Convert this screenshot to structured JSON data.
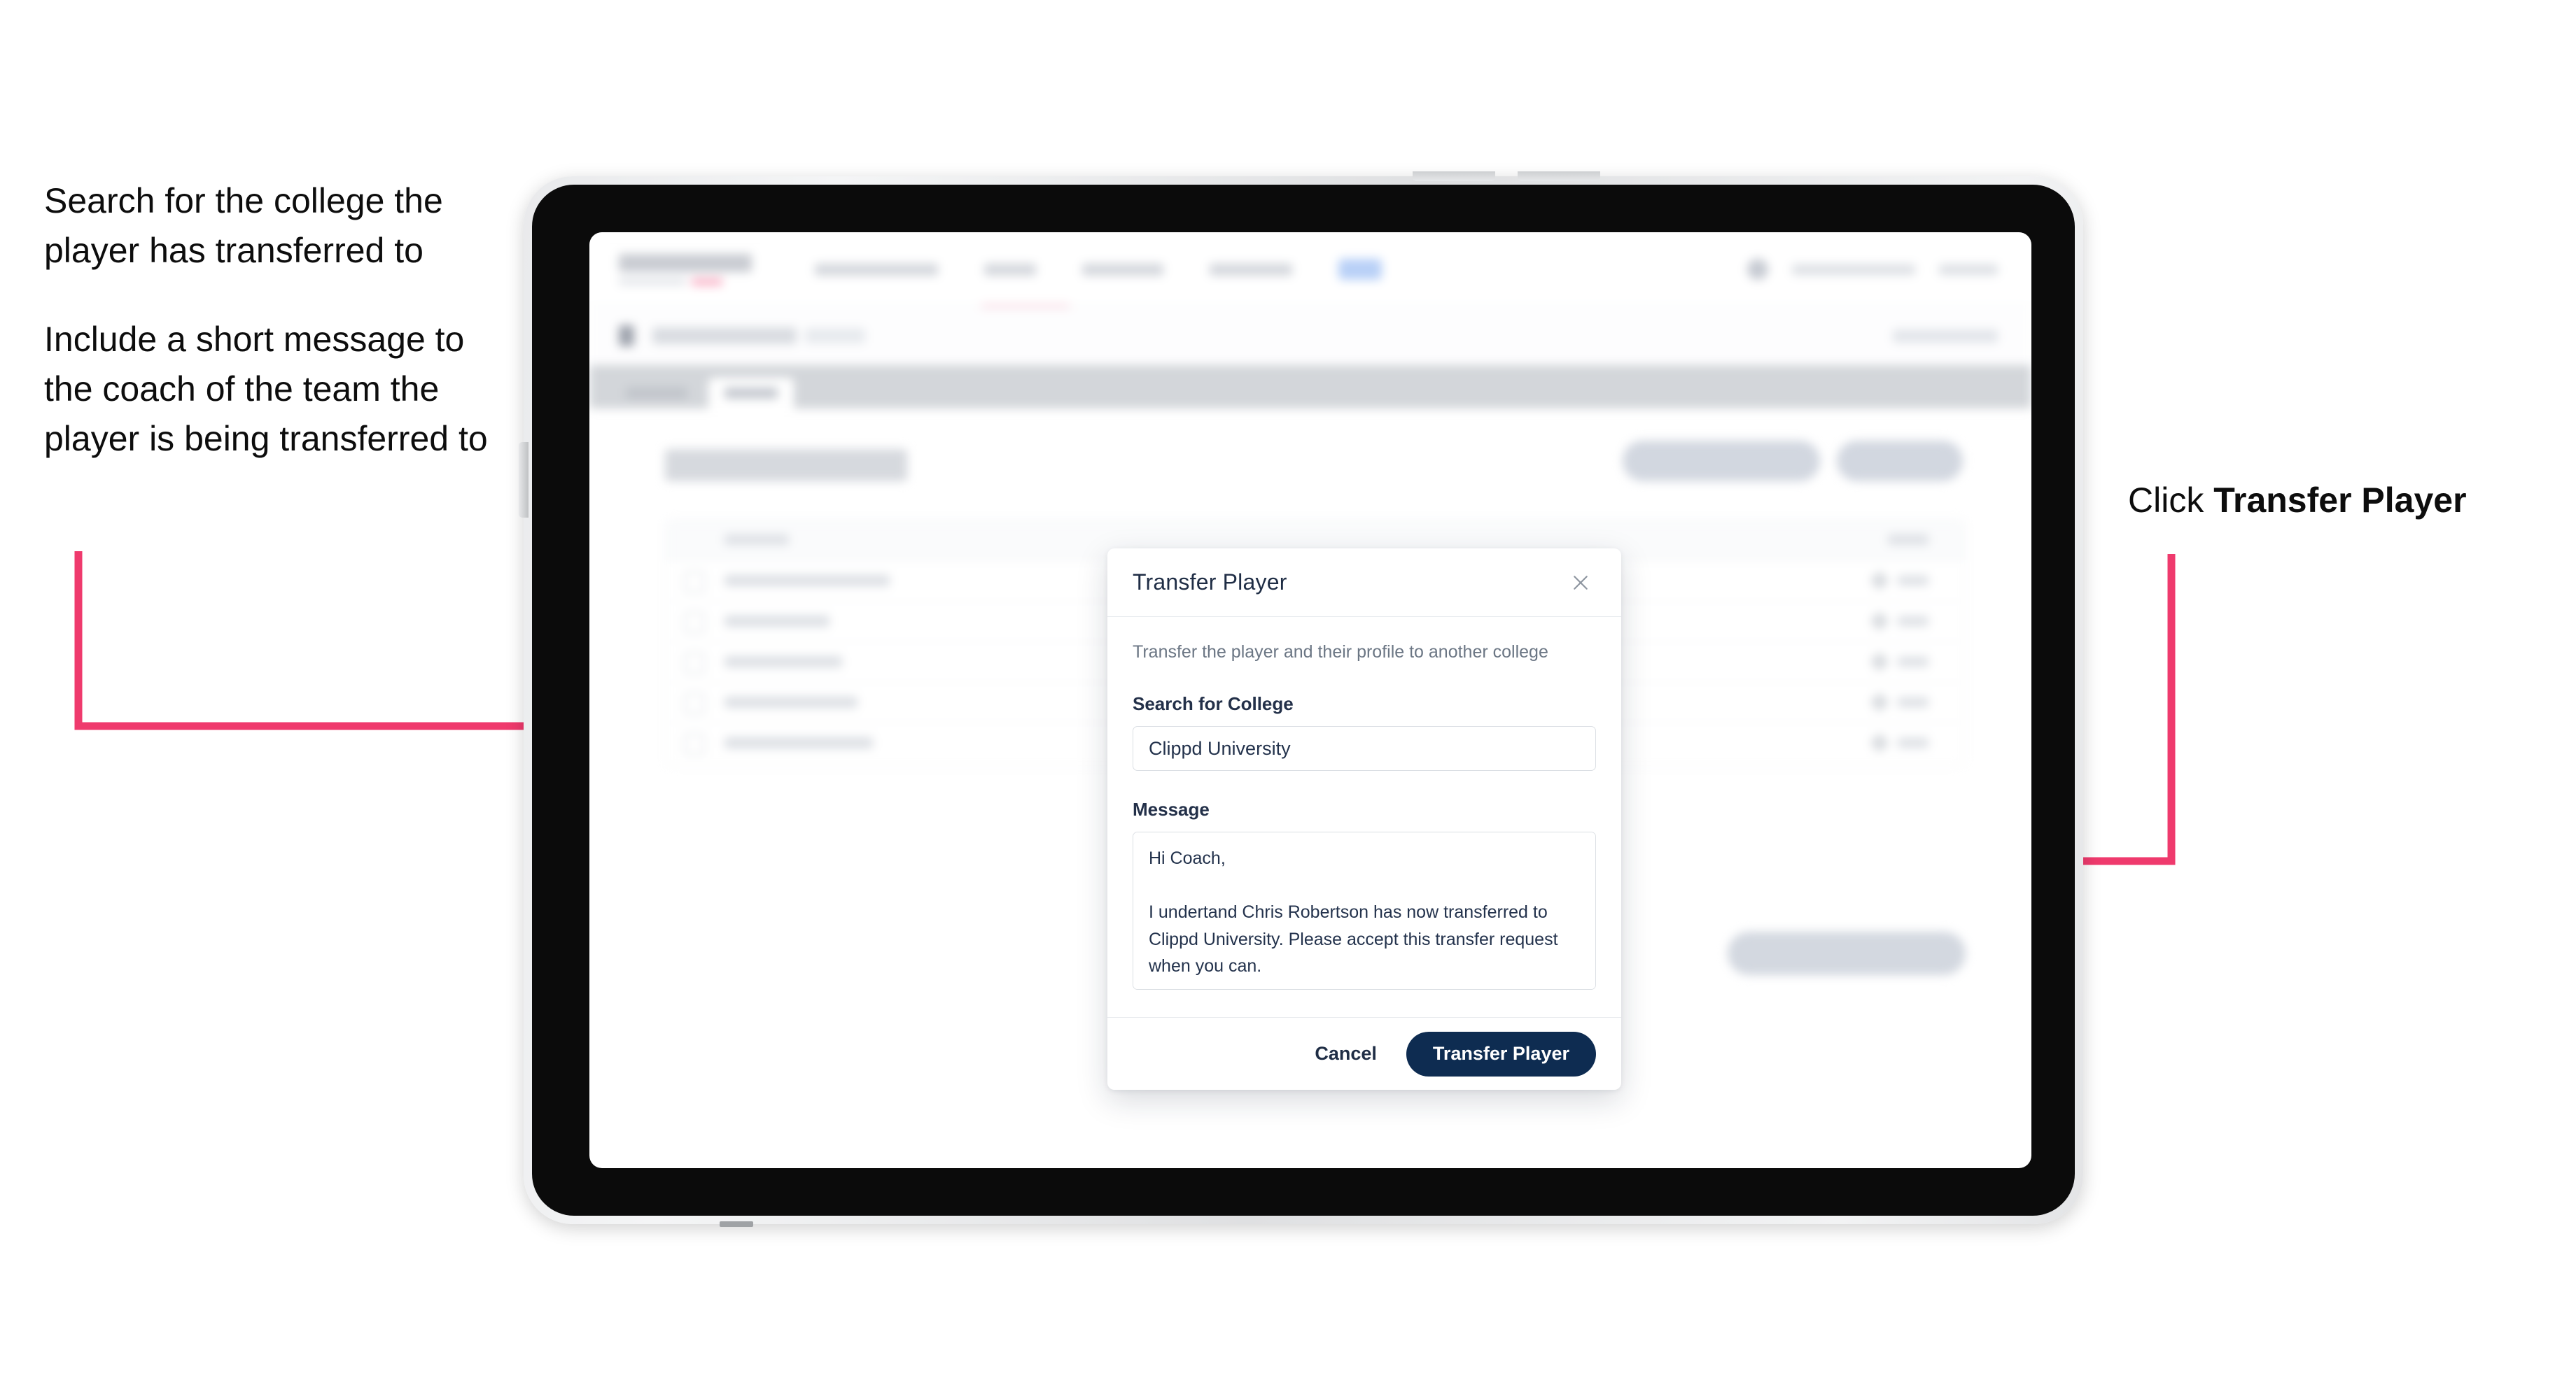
{
  "annotations": {
    "left": [
      "Search for the college the player has transferred to",
      "Include a short message to the coach of the team the player is being transferred to"
    ],
    "right_prefix": "Click ",
    "right_bold": "Transfer Player"
  },
  "modal": {
    "title": "Transfer Player",
    "close_icon": "close-icon",
    "description": "Transfer the player and their profile to another college",
    "college_label": "Search for College",
    "college_value": "Clippd University",
    "college_placeholder": "Search for College",
    "message_label": "Message",
    "message_value": "Hi Coach,\n\nI undertand Chris Robertson has now transferred to Clippd University. Please accept this transfer request when you can.",
    "message_placeholder": "Message",
    "cancel_label": "Cancel",
    "submit_label": "Transfer Player"
  },
  "colors": {
    "accent_pink": "#ef3a6d",
    "brand_navy": "#0e2c51",
    "border_grey": "#dbdfe4",
    "muted_text": "#6b7684"
  },
  "device": {
    "type": "tablet",
    "frame_color": "#e9eaec",
    "bezel_color": "#0b0b0b"
  }
}
